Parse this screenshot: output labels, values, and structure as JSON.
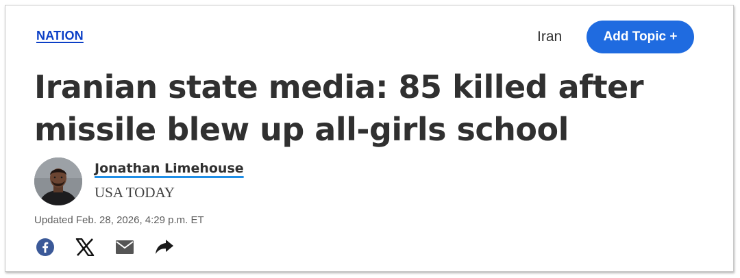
{
  "section": {
    "label": "NATION"
  },
  "topic": {
    "label": "Iran",
    "add_label": "Add Topic +"
  },
  "article": {
    "headline_line1": "Iranian state media: 85 killed after",
    "headline_line2": "missile blew up all-girls school",
    "author_name": "Jonathan Limehouse",
    "author_org": "USA TODAY",
    "updated": "Updated Feb. 28, 2026, 4:29 p.m. ET"
  },
  "share": {
    "icons": [
      "facebook-icon",
      "x-icon",
      "email-icon",
      "share-arrow-icon"
    ]
  },
  "colors": {
    "section_link": "#0b3fc6",
    "add_topic_button": "#1f6be0",
    "author_underline": "#1f8ee6",
    "facebook": "#3b5998",
    "headline": "#303030"
  }
}
